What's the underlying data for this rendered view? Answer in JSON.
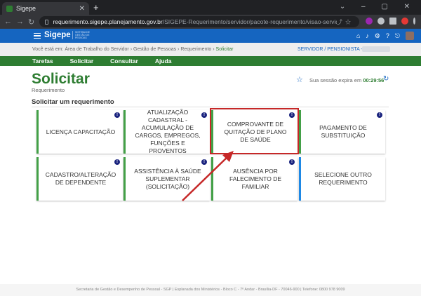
{
  "browser": {
    "tab_title": "Sigepe",
    "url_host": "requerimento.sigepe.planejamento.gov.br",
    "url_path": "/SIGEPE-Requerimento/servidor/pacote-requerimento/visao-servidor-solicitar.jsf?..."
  },
  "header": {
    "brand": "Sigepe",
    "brand_sub": "SISTEMA DE GESTÃO DE PESSOAS"
  },
  "breadcrumb": {
    "prefix": "Você está em:",
    "items": [
      "Área de Trabalho do Servidor",
      "Gestão de Pessoas",
      "Requerimento"
    ],
    "current": "Solicitar",
    "user": "SERVIDOR / PENSIONISTA - DPF"
  },
  "nav": {
    "items": [
      "Tarefas",
      "Solicitar",
      "Consultar",
      "Ajuda"
    ]
  },
  "page": {
    "title": "Solicitar",
    "subtitle": "Requerimento",
    "session_text": "Sua sessão expira em",
    "session_time": "00:29:56",
    "section_title": "Solicitar um requerimento"
  },
  "cards": [
    {
      "label": "LICENÇA CAPACITAÇÃO"
    },
    {
      "label": "ATUALIZAÇÃO CADASTRAL - ACUMULAÇÃO DE CARGOS, EMPREGOS, FUNÇÕES E PROVENTOS"
    },
    {
      "label": "COMPROVANTE DE QUITAÇÃO DE PLANO DE SAÚDE"
    },
    {
      "label": "PAGAMENTO DE SUBSTITUIÇÃO"
    },
    {
      "label": "CADASTRO/ALTERAÇÃO DE DEPENDENTE"
    },
    {
      "label": "ASSISTÊNCIA À SAÚDE SUPLEMENTAR (SOLICITAÇÃO)"
    },
    {
      "label": "AUSÊNCIA POR FALECIMENTO DE FAMILIAR"
    },
    {
      "label": "SELECIONE OUTRO REQUERIMENTO"
    }
  ],
  "footer": "Secretaria de Gestão e Desempenho de Pessoal - SGP | Esplanada dos Ministérios - Bloco C - 7º Andar - Brasília-DF - 70046-900 | Telefone: 0800 978 9009",
  "colors": {
    "header_blue": "#1565c0",
    "nav_green": "#2e7d32",
    "highlight_red": "#c62828"
  }
}
